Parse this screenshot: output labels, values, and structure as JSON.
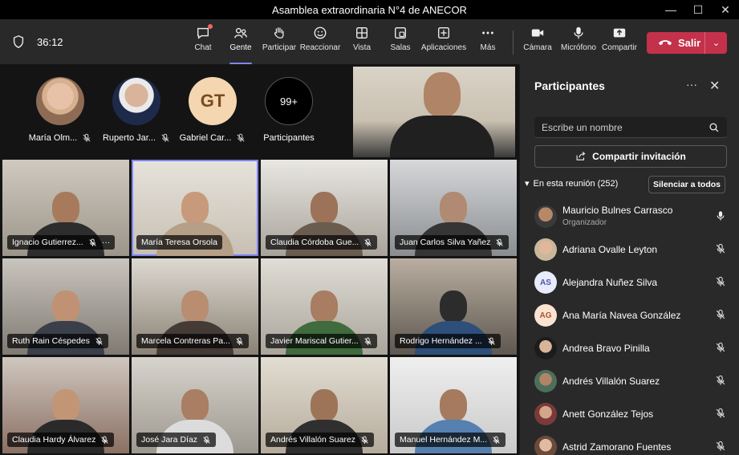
{
  "window": {
    "title": "Asamblea extraordinaria N°4 de ANECOR",
    "controls": [
      "—",
      "☐",
      "✕"
    ]
  },
  "toolbar": {
    "timer": "36:12",
    "buttons": [
      {
        "label": "Chat",
        "icon": "chat-icon"
      },
      {
        "label": "Gente",
        "icon": "people-icon",
        "active": true
      },
      {
        "label": "Participar",
        "icon": "raise-hand-icon"
      },
      {
        "label": "Reaccionar",
        "icon": "smiley-icon"
      },
      {
        "label": "Vista",
        "icon": "grid-view-icon"
      },
      {
        "label": "Salas",
        "icon": "breakout-rooms-icon"
      },
      {
        "label": "Aplicaciones",
        "icon": "add-apps-icon"
      },
      {
        "label": "Más",
        "icon": "more-icon"
      },
      {
        "label": "Cámara",
        "icon": "camera-icon"
      },
      {
        "label": "Micrófono",
        "icon": "microphone-icon"
      },
      {
        "label": "Compartir",
        "icon": "share-screen-icon"
      }
    ],
    "leave_label": "Salir",
    "leave_color": "#c4314b"
  },
  "stage": {
    "avatars": [
      {
        "caption": "María Olm..."
      },
      {
        "caption": "Ruperto Jar..."
      },
      {
        "caption": "Gabriel Car...",
        "initials": "GT"
      },
      {
        "caption": "Participantes",
        "count": "99+"
      }
    ],
    "tiles": [
      {
        "name": "Ignacio Gutierrez...",
        "more": "···"
      },
      {
        "name": "María Teresa Orsola",
        "selected": true
      },
      {
        "name": "Claudia Córdoba Gue..."
      },
      {
        "name": "Juan Carlos Silva Yañez"
      },
      {
        "name": "Ruth Rain Céspedes"
      },
      {
        "name": "Marcela Contreras Pa..."
      },
      {
        "name": "Javier Mariscal Gutier..."
      },
      {
        "name": "Rodrigo Hernández ..."
      },
      {
        "name": "Claudia Hardy Álvarez"
      },
      {
        "name": "José Jara Díaz"
      },
      {
        "name": "Andrés Villalón Suarez"
      },
      {
        "name": "Manuel Hernández M..."
      }
    ]
  },
  "panel": {
    "title": "Participantes",
    "search_placeholder": "Escribe un nombre",
    "share_label": "Compartir invitación",
    "section_label": "En esta reunión (252)",
    "mute_all_label": "Silenciar a todos",
    "participants": [
      {
        "name": "Mauricio Bulnes Carrasco",
        "role": "Organizador",
        "mic": "on"
      },
      {
        "name": "Adriana Ovalle Leyton",
        "mic": "muted"
      },
      {
        "name": "Alejandra Nuñez Silva",
        "initials": "AS",
        "mic": "muted"
      },
      {
        "name": "Ana María Navea González",
        "initials": "AG",
        "mic": "muted"
      },
      {
        "name": "Andrea Bravo Pinilla",
        "mic": "muted"
      },
      {
        "name": "Andrés Villalón Suarez",
        "mic": "muted"
      },
      {
        "name": "Anett González Tejos",
        "mic": "muted"
      },
      {
        "name": "Astrid Zamorano Fuentes",
        "mic": "muted"
      }
    ]
  },
  "colors": {
    "accent": "#7f85f5",
    "leave": "#c4314b",
    "bg": "#1f1f1f"
  }
}
